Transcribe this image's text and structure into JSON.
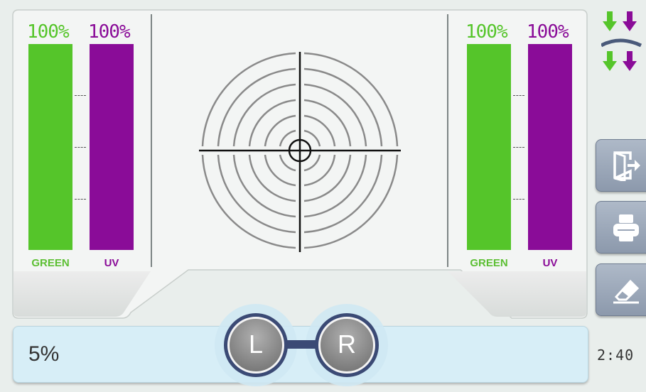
{
  "left_panel": {
    "green": {
      "percent_text": "100%",
      "label": "GREEN",
      "level": 1.0
    },
    "uv": {
      "percent_text": "100%",
      "label": "UV",
      "level": 1.0
    }
  },
  "right_panel": {
    "green": {
      "percent_text": "100%",
      "label": "GREEN",
      "level": 1.0
    },
    "uv": {
      "percent_text": "100%",
      "label": "UV",
      "level": 1.0
    }
  },
  "bottom": {
    "percent_text": "5%",
    "left_eye_label": "L",
    "right_eye_label": "R"
  },
  "side": {
    "buttons": [
      "exit-door-icon",
      "printer-icon",
      "eraser-icon"
    ],
    "filter_icon": "green-purple-arrows-icon",
    "clock": "2:40"
  },
  "colors": {
    "green": "#55c52a",
    "uv": "#8a0c98",
    "panel": "#f2f5f3",
    "bottom_bar": "#d7eef7",
    "button": "#9aa6b8"
  }
}
